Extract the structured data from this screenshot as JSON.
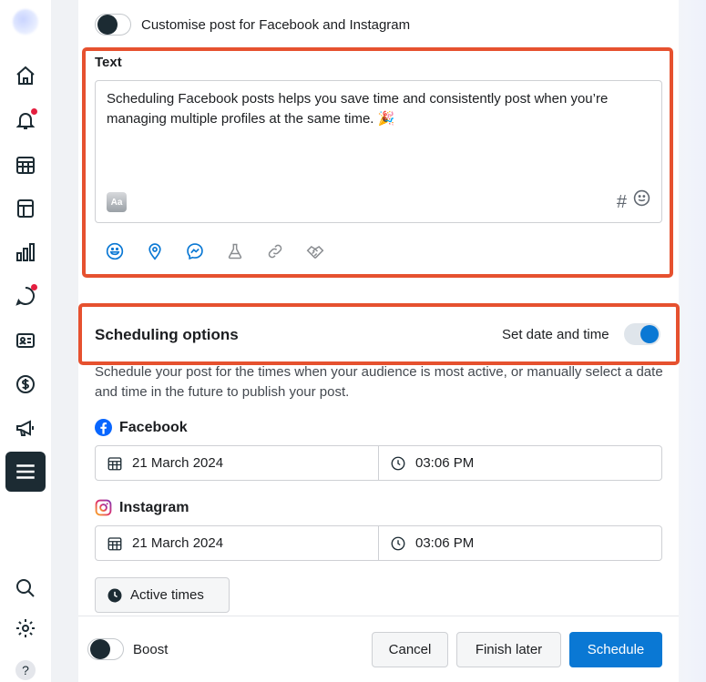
{
  "customise": {
    "label": "Customise post for Facebook and Instagram",
    "enabled": false
  },
  "text_section": {
    "title": "Text",
    "content": "Scheduling Facebook posts helps you save time and consistently post when you’re managing multiple profiles at the same time. 🎉",
    "format_icon_text": "Aa",
    "hashtag_symbol": "#"
  },
  "scheduling": {
    "title": "Scheduling options",
    "set_date_label": "Set date and time",
    "set_date_enabled": true,
    "description": "Schedule your post for the times when your audience is most active, or manually select a date and time in the future to publish your post.",
    "facebook": {
      "label": "Facebook",
      "date": "21 March 2024",
      "time": "03:06 PM"
    },
    "instagram": {
      "label": "Instagram",
      "date": "21 March 2024",
      "time": "03:06 PM"
    },
    "active_times_label": "Active times"
  },
  "footer": {
    "boost_label": "Boost",
    "boost_enabled": false,
    "cancel_label": "Cancel",
    "finish_later_label": "Finish later",
    "schedule_label": "Schedule"
  },
  "colors": {
    "accent": "#0a78d4",
    "highlight": "#e6512f",
    "notification": "#e41e3f",
    "nav_active": "#1c2b33"
  },
  "sidebar_icons": [
    "home-icon",
    "bell-icon",
    "calendar-grid-icon",
    "content-icon",
    "insights-icon",
    "inbox-icon",
    "contact-card-icon",
    "dollar-icon",
    "megaphone-icon",
    "menu-icon",
    "search-icon",
    "gear-icon",
    "help-icon"
  ],
  "sidebar_help_glyph": "?"
}
